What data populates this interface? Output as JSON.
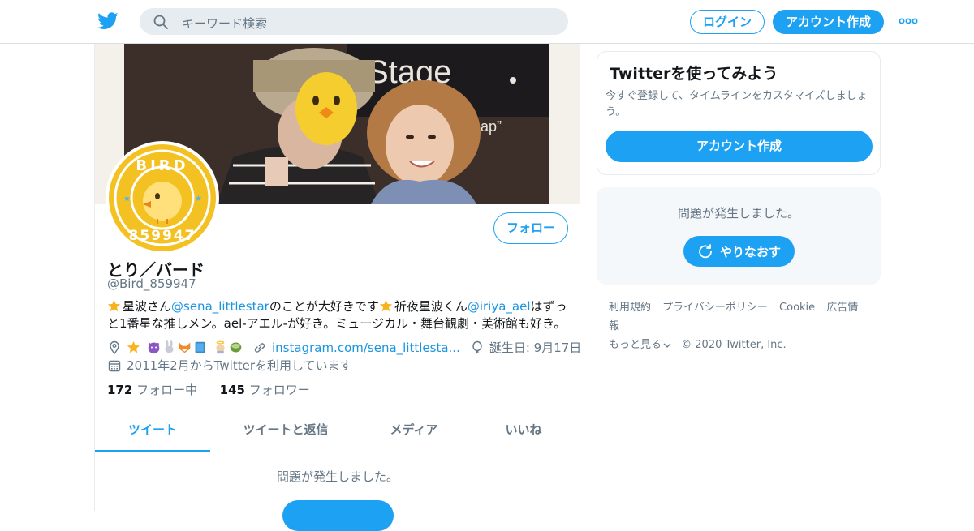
{
  "header": {
    "search_placeholder": "キーワード検索",
    "login_label": "ログイン",
    "signup_label": "アカウント作成"
  },
  "profile": {
    "display_name": "とり／バード",
    "handle": "@Bird_859947",
    "follow_label": "フォロー",
    "avatar_text_top": "BIRD",
    "avatar_text_bottom": "859947",
    "banner_sign": "Stage",
    "banner_sign_small": "ofmap”",
    "bio": {
      "part1": "星波さん",
      "mention1": "@sena_littlestar",
      "part2": "のことが大好きです",
      "part3": "祈夜星波くん",
      "mention2": "@iriya_ael",
      "part4": "はずっと1番星な推しメン。ael-アエル-が好き。ミュージカル・舞台観劇・美術館も好き。"
    },
    "website": "instagram.com/sena_littlesta...",
    "birthday": "誕生日: 9月17日",
    "joined": "2011年2月からTwitterを利用しています",
    "following_count": "172",
    "following_label": "フォロー中",
    "followers_count": "145",
    "followers_label": "フォロワー"
  },
  "tabs": [
    {
      "label": "ツイート",
      "active": true
    },
    {
      "label": "ツイートと返信",
      "active": false
    },
    {
      "label": "メディア",
      "active": false
    },
    {
      "label": "いいね",
      "active": false
    }
  ],
  "main": {
    "error_text": "問題が発生しました。"
  },
  "sidebar": {
    "signup_heading": "Twitterを使ってみよう",
    "signup_desc": "今すぐ登録して、タイムラインをカスタマイズしましょう。",
    "signup_button": "アカウント作成",
    "error_text": "問題が発生しました。",
    "retry_label": "やりなおす"
  },
  "footer": {
    "terms": "利用規約",
    "privacy": "プライバシーポリシー",
    "cookie": "Cookie",
    "ads": "広告情報",
    "more": "もっと見る",
    "copyright": "© 2020 Twitter, Inc."
  },
  "colors": {
    "accent": "#1da1f2",
    "link": "#1b95e0",
    "muted": "#657786"
  }
}
